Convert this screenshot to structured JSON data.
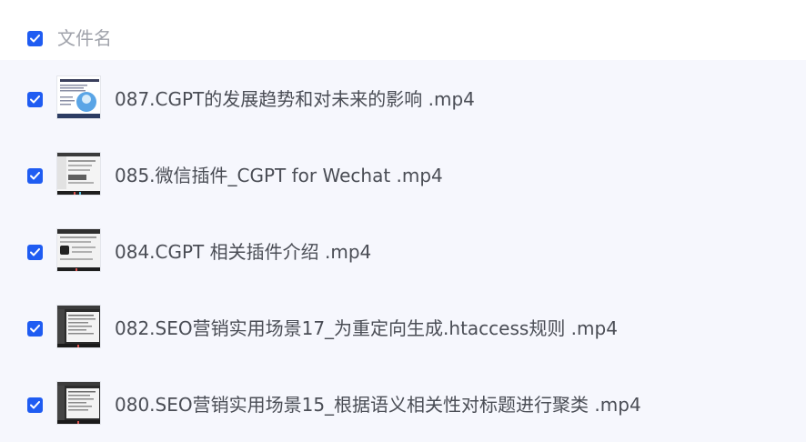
{
  "header": {
    "column_label": "文件名",
    "select_all_checked": true
  },
  "files": [
    {
      "name": "087.CGPT的发展趋势和对未来的影响 .mp4",
      "checked": true,
      "thumb": "slide"
    },
    {
      "name": "085.微信插件_CGPT for Wechat .mp4",
      "checked": true,
      "thumb": "screen"
    },
    {
      "name": "084.CGPT 相关插件介绍 .mp4",
      "checked": true,
      "thumb": "screen"
    },
    {
      "name": "082.SEO营销实用场景17_为重定向生成.htaccess规则 .mp4",
      "checked": true,
      "thumb": "editor"
    },
    {
      "name": "080.SEO营销实用场景15_根据语义相关性对标题进行聚类 .mp4",
      "checked": true,
      "thumb": "editor"
    }
  ],
  "colors": {
    "checkbox": "#1f5cf2",
    "list_bg": "#f6f7fd",
    "text": "#4a4d55",
    "header_text": "#a0a3ab"
  }
}
